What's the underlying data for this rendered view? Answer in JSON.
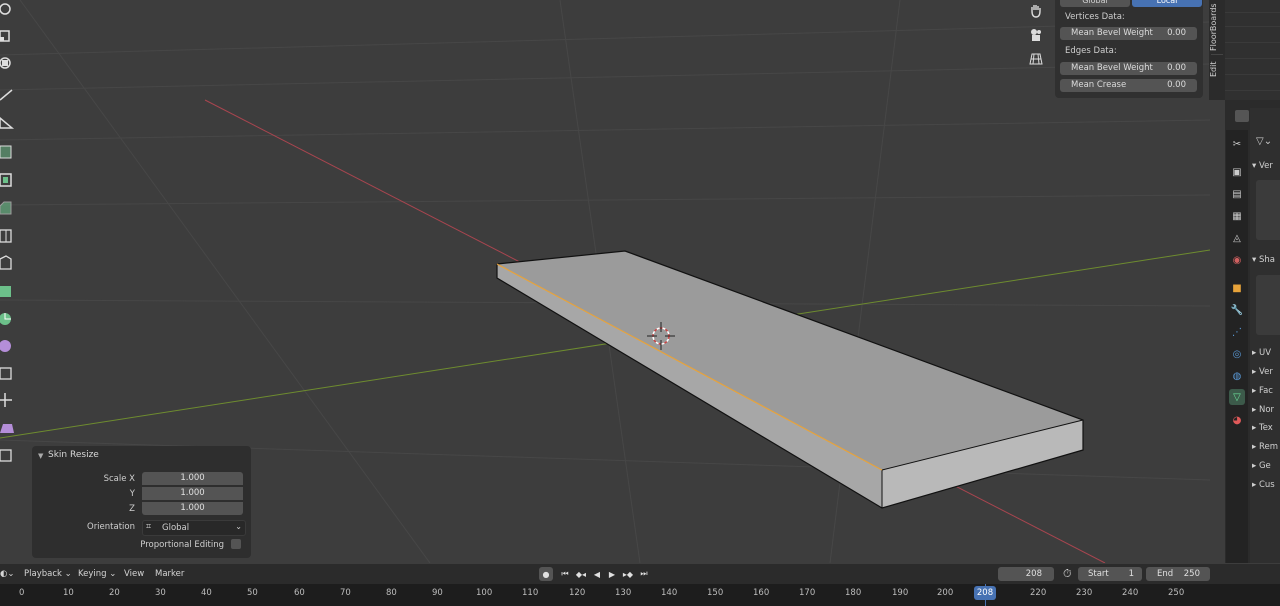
{
  "npanel": {
    "orientation_global": "Global",
    "orientation_local": "Local",
    "vertices_label": "Vertices Data:",
    "vertex_bevel_label": "Mean Bevel Weight",
    "vertex_bevel_value": "0.00",
    "edges_label": "Edges Data:",
    "edge_bevel_label": "Mean Bevel Weight",
    "edge_bevel_value": "0.00",
    "crease_label": "Mean Crease",
    "crease_value": "0.00"
  },
  "sidebar_tabs": {
    "tab1": "FloorBoards",
    "tab2": "Edit"
  },
  "properties": {
    "rows": [
      "Ver",
      "Sha",
      "UV",
      "Ver",
      "Fac",
      "Nor",
      "Tex",
      "Rem",
      "Ge",
      "Cus"
    ]
  },
  "redo_panel": {
    "title": "Skin Resize",
    "scale_x_label": "Scale X",
    "scale_x": "1.000",
    "y_label": "Y",
    "y": "1.000",
    "z_label": "Z",
    "z": "1.000",
    "orientation_label": "Orientation",
    "orientation_value": "Global",
    "proportional_label": "Proportional Editing"
  },
  "timeline": {
    "playback": "Playback",
    "keying": "Keying",
    "view": "View",
    "marker": "Marker",
    "current_frame": "208",
    "start_label": "Start",
    "start": "1",
    "end_label": "End",
    "end": "250",
    "ticks": [
      "0",
      "10",
      "20",
      "30",
      "40",
      "50",
      "60",
      "70",
      "80",
      "90",
      "100",
      "110",
      "120",
      "130",
      "140",
      "150",
      "160",
      "170",
      "180",
      "190",
      "200",
      "208",
      "220",
      "230",
      "240",
      "250"
    ]
  },
  "colors": {
    "accent": "#4772b3",
    "selected_edge": "#e8a33a",
    "x_axis": "#a8454f",
    "y_axis": "#6e8c2f"
  }
}
